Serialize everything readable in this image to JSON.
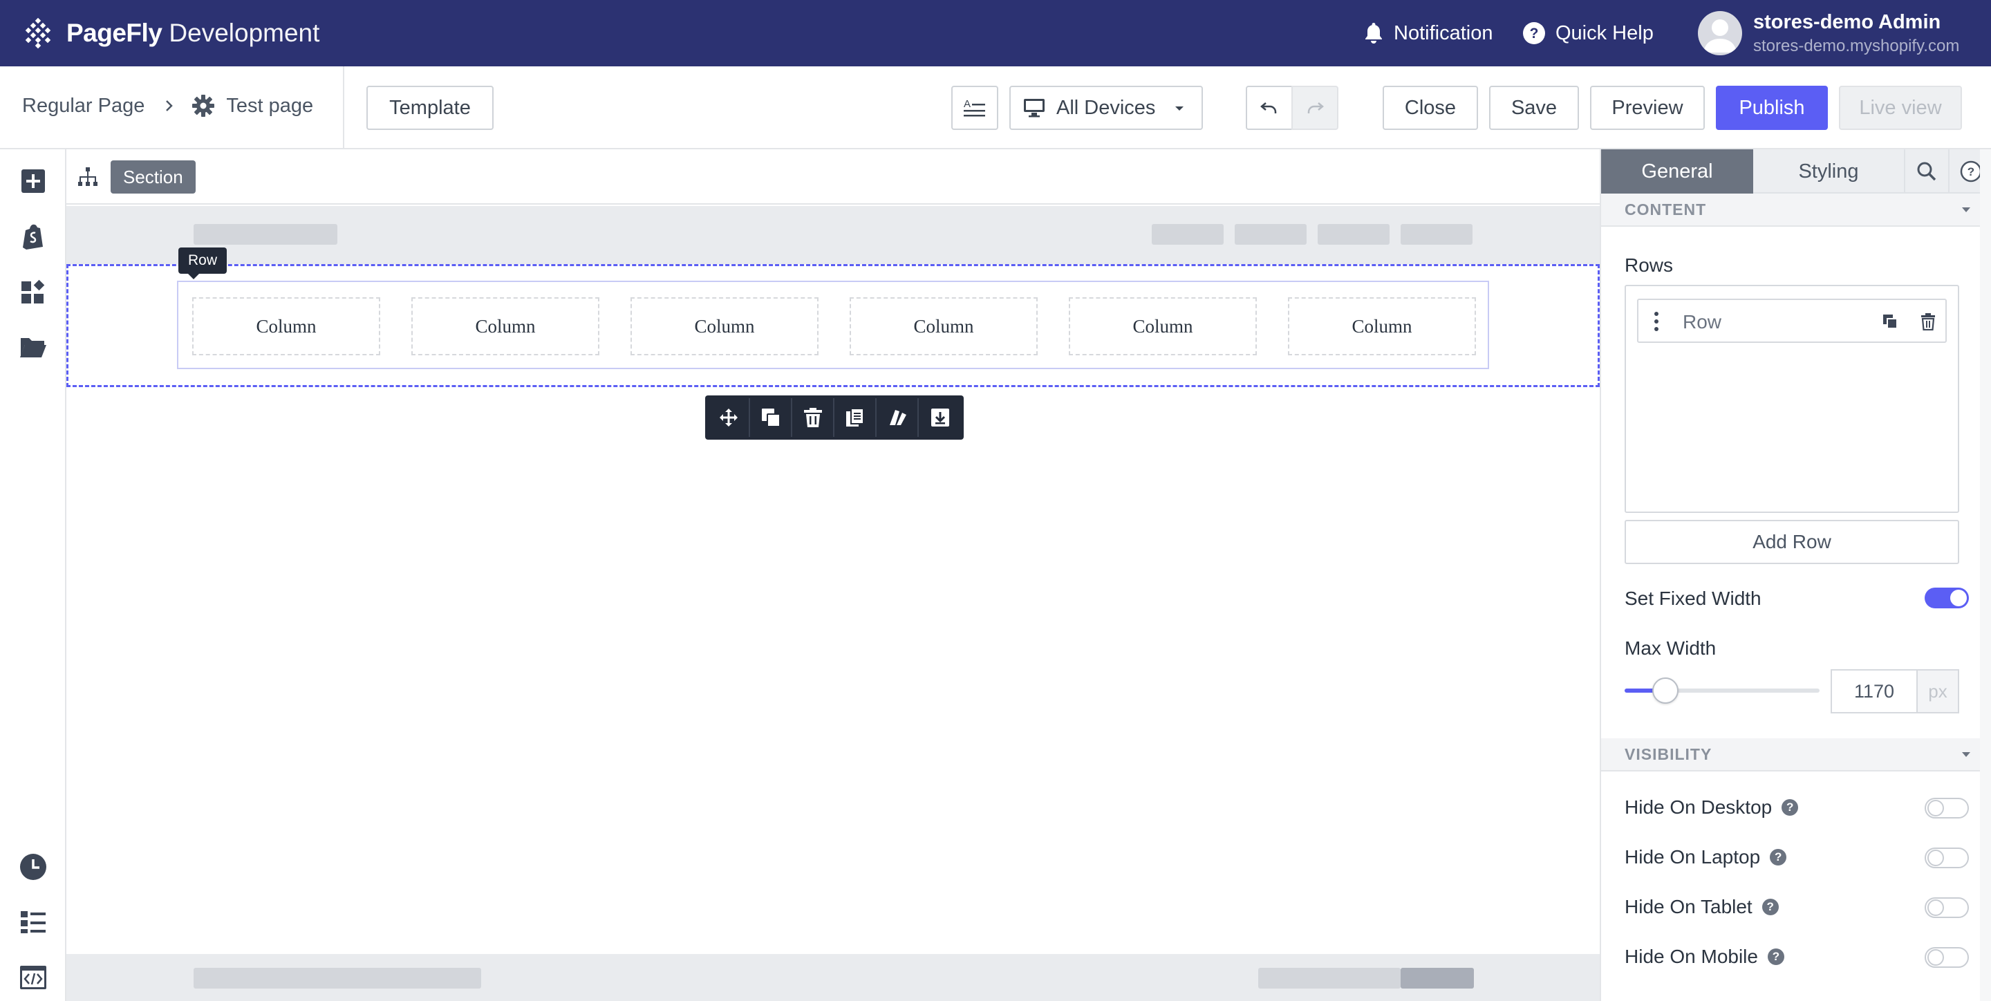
{
  "app": {
    "brand": "PageFly",
    "brand_suffix": "Development",
    "notification": "Notification",
    "quick_help": "Quick Help",
    "user_name": "stores-demo Admin",
    "user_store": "stores-demo.myshopify.com"
  },
  "toolbar": {
    "breadcrumb_parent": "Regular Page",
    "breadcrumb_current": "Test page",
    "template": "Template",
    "device": "All Devices",
    "close": "Close",
    "save": "Save",
    "preview": "Preview",
    "publish": "Publish",
    "live_view": "Live view"
  },
  "canvas": {
    "breadcrumb": "Section",
    "row_tag": "Row",
    "columns": [
      "Column",
      "Column",
      "Column",
      "Column",
      "Column",
      "Column"
    ]
  },
  "panel": {
    "tab_general": "General",
    "tab_styling": "Styling",
    "content_header": "CONTENT",
    "rows_label": "Rows",
    "row_item": "Row",
    "add_row": "Add Row",
    "fixed_width_label": "Set Fixed Width",
    "fixed_width_on": true,
    "max_width_label": "Max Width",
    "max_width_value": "1170",
    "max_width_unit": "px",
    "max_width_slider_fraction": 0.21,
    "visibility_header": "VISIBILITY",
    "hide_desktop": "Hide On Desktop",
    "hide_laptop": "Hide On Laptop",
    "hide_tablet": "Hide On Tablet",
    "hide_mobile": "Hide On Mobile"
  },
  "colors": {
    "topbar": "#2c3272",
    "accent": "#5b5ef4",
    "dark_tools": "#232a38"
  }
}
